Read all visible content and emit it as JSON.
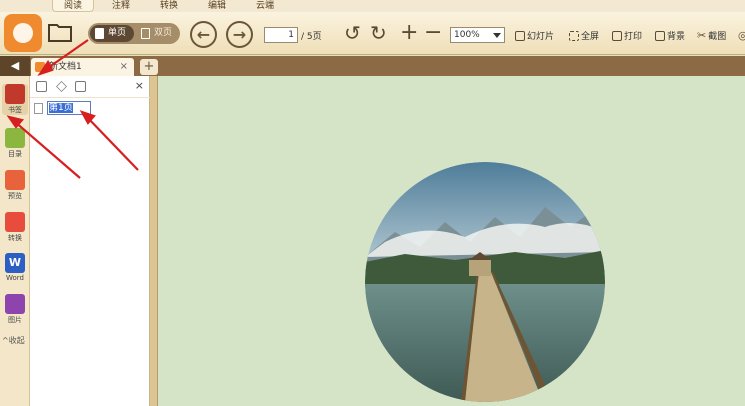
{
  "menu": {
    "tabs": [
      {
        "label": "阅读"
      },
      {
        "label": "注释"
      },
      {
        "label": "转换"
      },
      {
        "label": "编辑"
      },
      {
        "label": "云端"
      }
    ]
  },
  "toolbar": {
    "single_page": "单页",
    "double_page": "双页",
    "page_current": "1",
    "page_total": "/ 5页",
    "zoom": "100%",
    "slideshow": "幻灯片",
    "fullscreen": "全屏",
    "print": "打印",
    "background": "背景",
    "screenshot": "截图"
  },
  "document_tab": {
    "title": "新文档1",
    "close": "×",
    "add": "+"
  },
  "sidebar": {
    "items": [
      {
        "label": "书签",
        "icon": "bookmark-icon",
        "color": "#c0392b"
      },
      {
        "label": "目录",
        "icon": "toc-icon",
        "color": "#8bb741"
      },
      {
        "label": "预览",
        "icon": "preview-icon",
        "color": "#e8633b"
      },
      {
        "label": "转换",
        "icon": "convert-icon",
        "color": "#e74c3c"
      },
      {
        "label": "Word",
        "icon": "word-icon",
        "color": "#2b5fc4"
      },
      {
        "label": "图片",
        "icon": "image-icon",
        "color": "#8e44ad"
      }
    ],
    "collapse_label": "收起"
  },
  "bookmark_panel": {
    "close": "×",
    "items": [
      {
        "label": "第1页"
      }
    ]
  },
  "colors": {
    "toolbar_brown": "#8c6a45",
    "viewer_bg": "#d5e4c6",
    "annotation_red": "#d62020"
  }
}
